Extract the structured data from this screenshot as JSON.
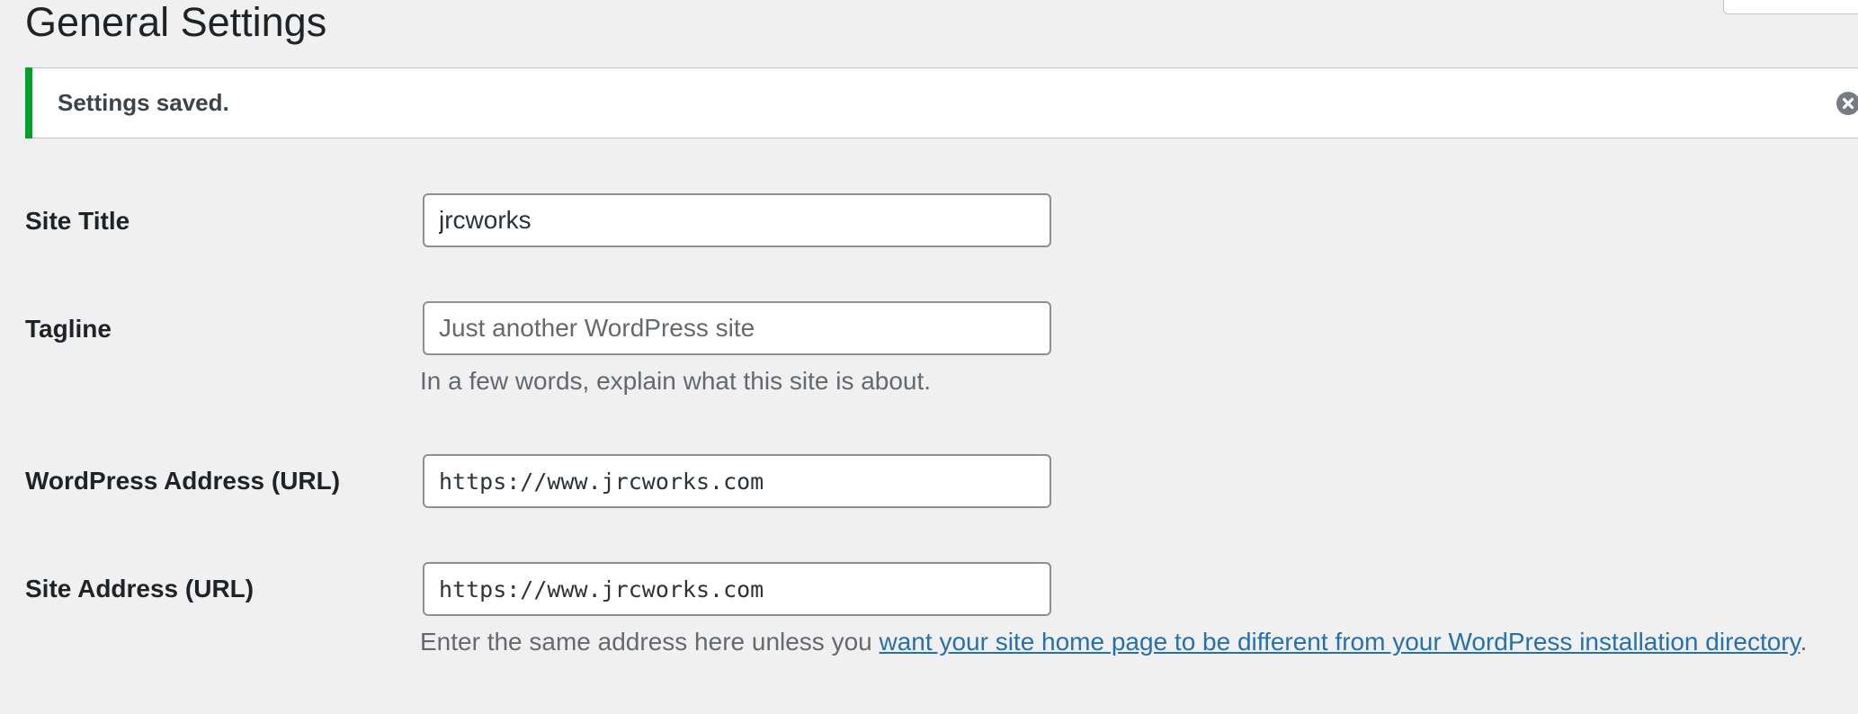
{
  "page": {
    "title": "General Settings"
  },
  "notice": {
    "message": "Settings saved.",
    "accent_color": "#00a32a",
    "dismiss_icon": "close-circle-icon"
  },
  "fields": {
    "site_title": {
      "label": "Site Title",
      "value": "jrcworks"
    },
    "tagline": {
      "label": "Tagline",
      "value": "",
      "placeholder": "Just another WordPress site",
      "description": "In a few words, explain what this site is about."
    },
    "wordpress_address": {
      "label": "WordPress Address (URL)",
      "value": "https://www.jrcworks.com"
    },
    "site_address": {
      "label": "Site Address (URL)",
      "value": "https://www.jrcworks.com",
      "description_prefix": "Enter the same address here unless you ",
      "description_link": "want your site home page to be different from your WordPress installation directory",
      "description_suffix": "."
    }
  },
  "colors": {
    "link": "#2271b1",
    "background": "#f0f0f1"
  }
}
